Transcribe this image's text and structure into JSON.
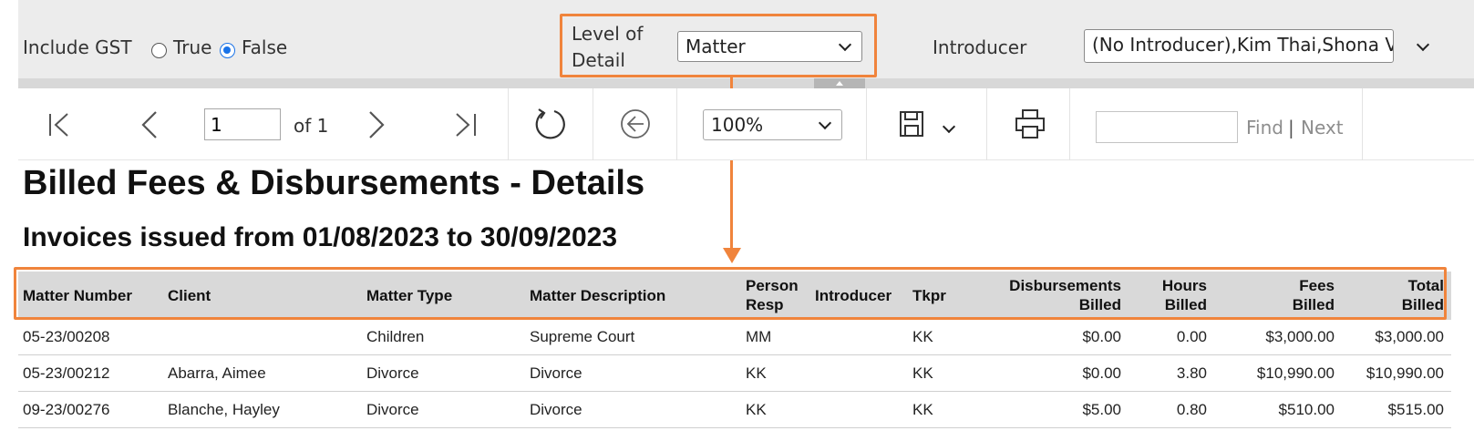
{
  "params": {
    "gst_label": "Include GST",
    "gst_true_label": "True",
    "gst_false_label": "False",
    "gst_selected": "False",
    "level_label_line1": "Level of",
    "level_label_line2": "Detail",
    "level_value": "Matter",
    "introducer_label": "Introducer",
    "introducer_value": "(No Introducer),Kim Thai,Shona  V..."
  },
  "toolbar": {
    "page_value": "1",
    "page_of": "of 1",
    "zoom_value": "100%",
    "find_label": "Find",
    "find_sep": "|",
    "next_label": "Next"
  },
  "report": {
    "title": "Billed Fees & Disbursements - Details",
    "subtitle": "Invoices issued from 01/08/2023 to 30/09/2023",
    "columns": {
      "matter_number": "Matter Number",
      "client": "Client",
      "matter_type": "Matter Type",
      "matter_description": "Matter Description",
      "person_resp_1": "Person",
      "person_resp_2": "Resp",
      "introducer": "Introducer",
      "tkpr": "Tkpr",
      "disb_1": "Disbursements",
      "disb_2": "Billed",
      "hours_1": "Hours",
      "hours_2": "Billed",
      "fees_1": "Fees",
      "fees_2": "Billed",
      "total_1": "Total",
      "total_2": "Billed"
    },
    "rows": [
      {
        "matter": "05-23/00208",
        "client": "",
        "type": "Children",
        "desc": "Supreme Court",
        "resp": "MM",
        "introducer": "",
        "tkpr": "KK",
        "disb": "$0.00",
        "hours": "0.00",
        "fees": "$3,000.00",
        "total": "$3,000.00"
      },
      {
        "matter": "05-23/00212",
        "client": "Abarra, Aimee",
        "type": "Divorce",
        "desc": "Divorce",
        "resp": "KK",
        "introducer": "",
        "tkpr": "KK",
        "disb": "$0.00",
        "hours": "3.80",
        "fees": "$10,990.00",
        "total": "$10,990.00"
      },
      {
        "matter": "09-23/00276",
        "client": "Blanche, Hayley",
        "type": "Divorce",
        "desc": "Divorce",
        "resp": "KK",
        "introducer": "",
        "tkpr": "KK",
        "disb": "$5.00",
        "hours": "0.80",
        "fees": "$510.00",
        "total": "$515.00"
      }
    ]
  },
  "colors": {
    "highlight": "#f0843c",
    "radio_selected": "#1a73e8",
    "header_bg": "#d9d9d9"
  },
  "icons": [
    "first-page-icon",
    "previous-page-icon",
    "next-page-icon",
    "last-page-icon",
    "refresh-icon",
    "back-icon",
    "save-icon",
    "print-icon"
  ]
}
